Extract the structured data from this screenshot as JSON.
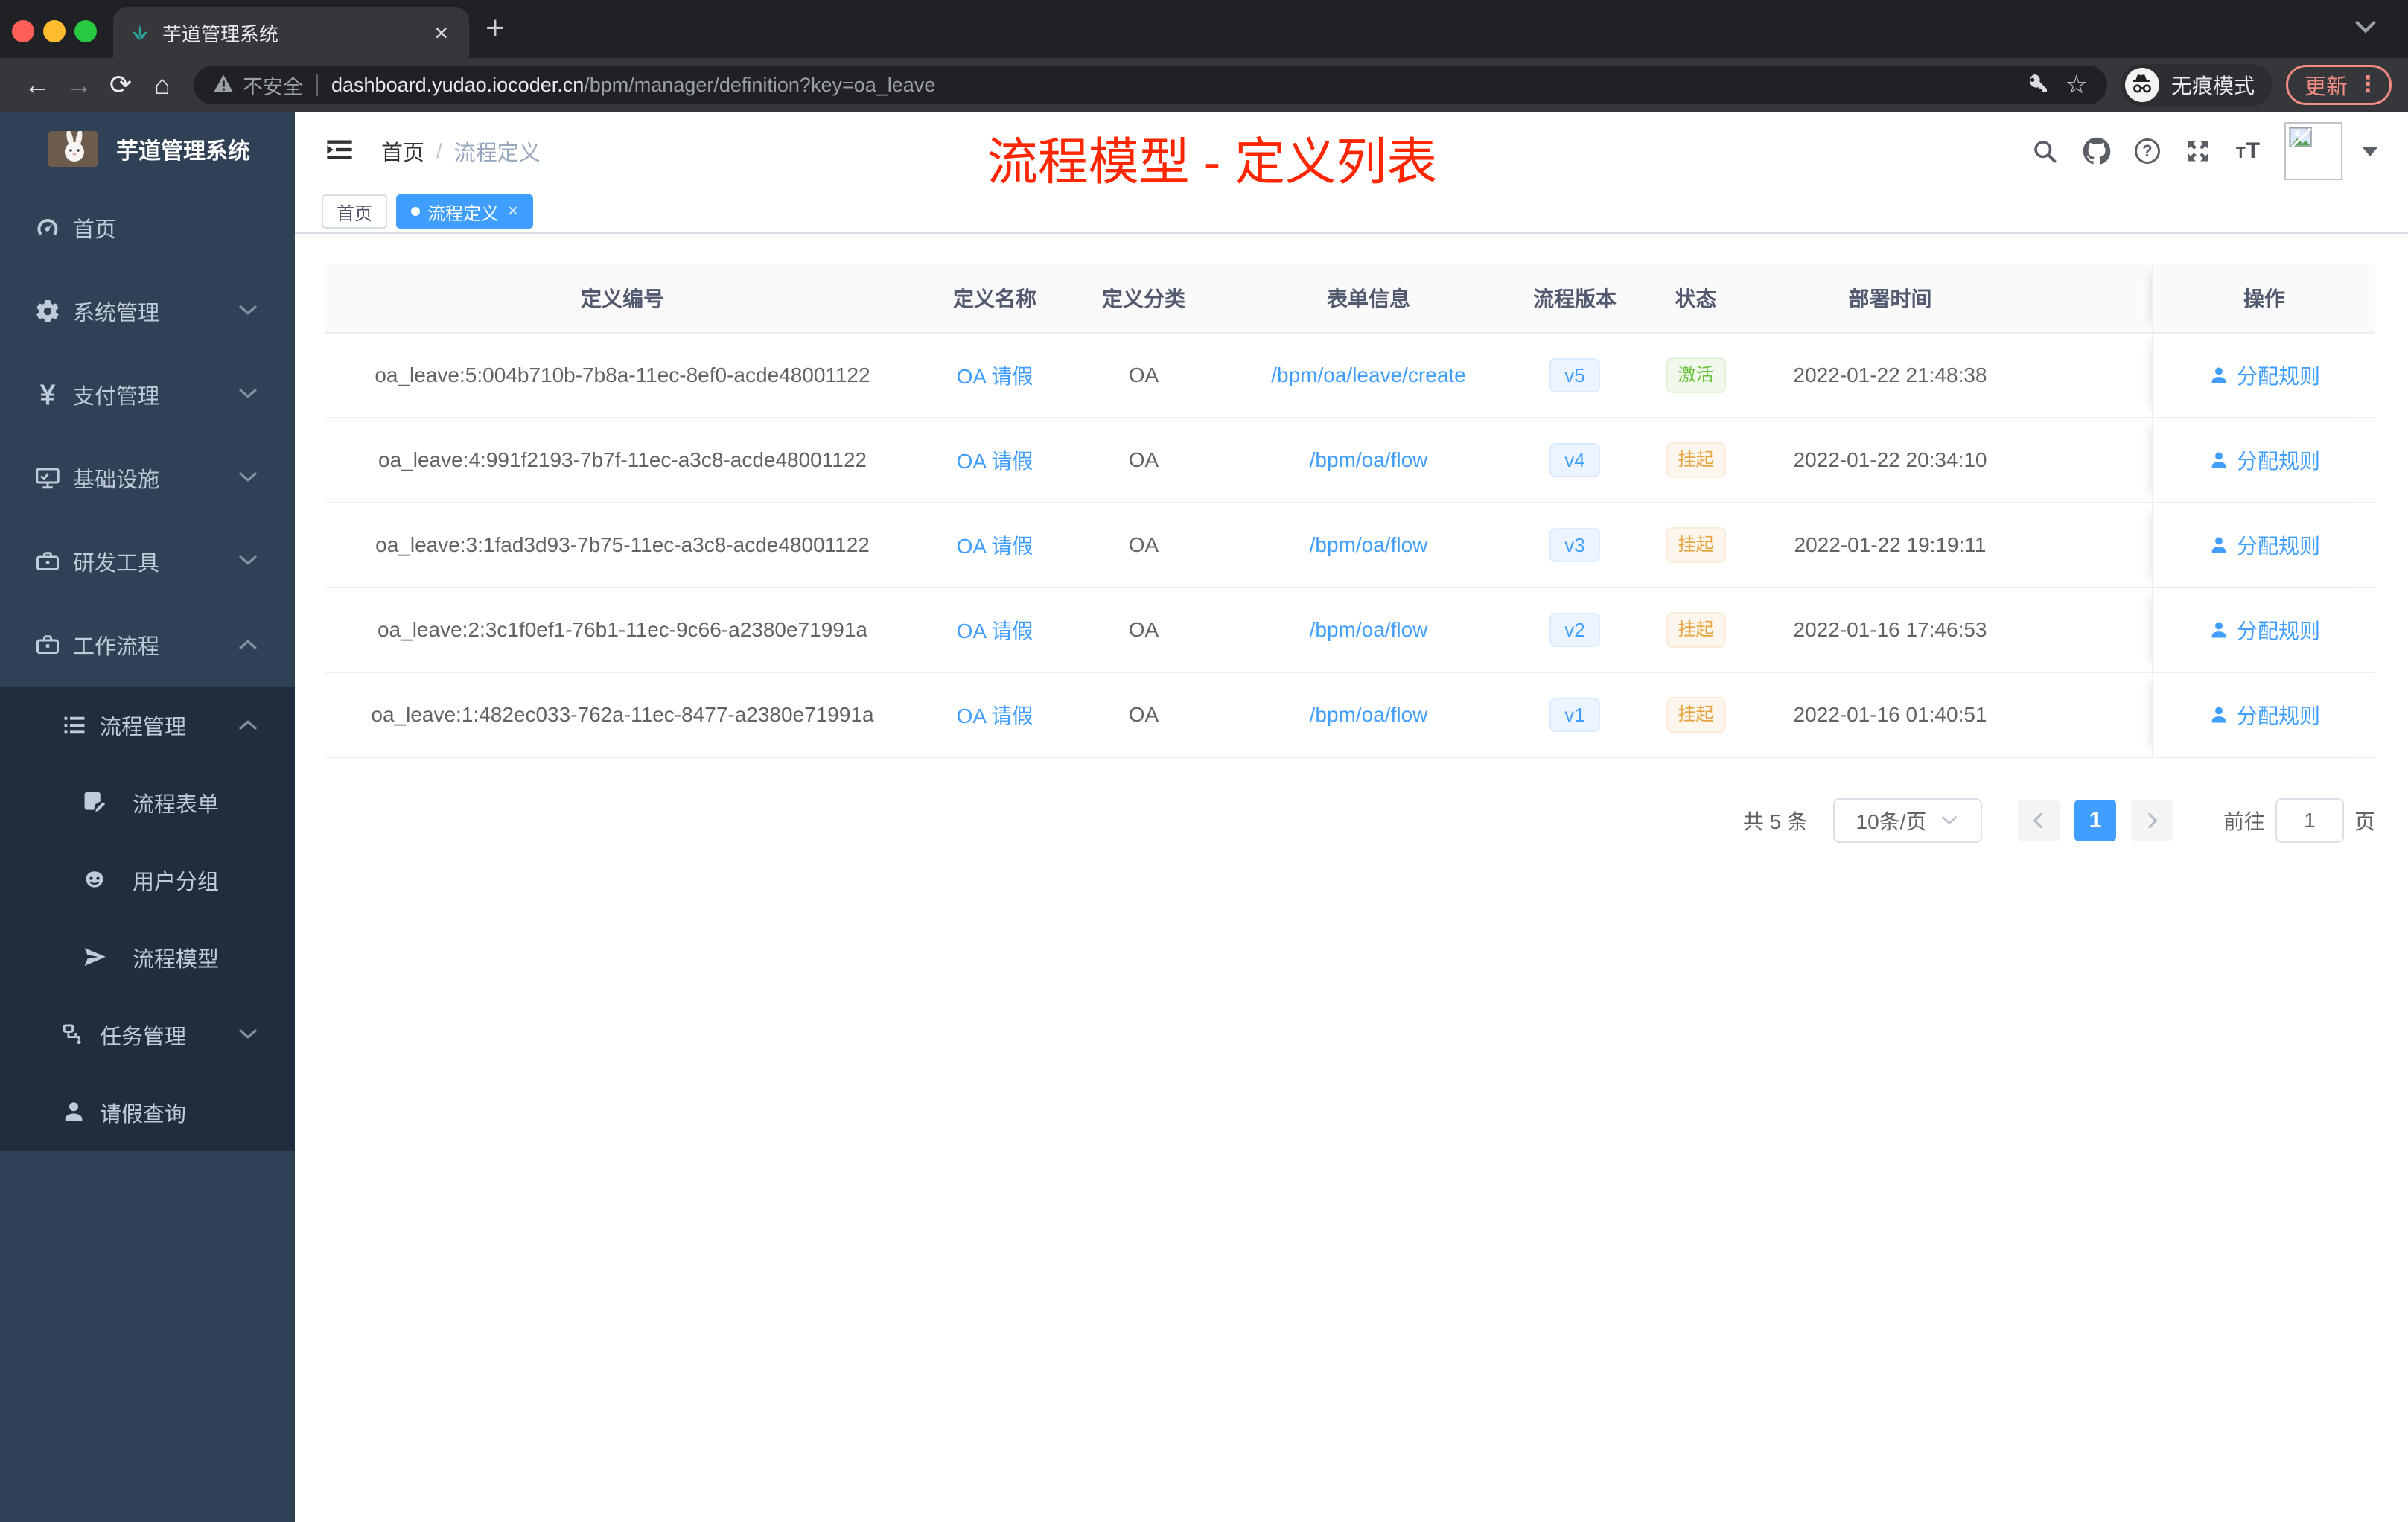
{
  "browser": {
    "tab": {
      "title": "芋道管理系统"
    },
    "address": {
      "security": "不安全",
      "host": "dashboard.yudao.iocoder.cn",
      "path": "/bpm/manager/definition?key=oa_leave"
    },
    "incognito_label": "无痕模式",
    "update_label": "更新"
  },
  "annotation": {
    "title": "流程模型 - 定义列表"
  },
  "sidebar": {
    "logo_title": "芋道管理系统",
    "menu": [
      {
        "label": "首页"
      },
      {
        "label": "系统管理"
      },
      {
        "label": "支付管理"
      },
      {
        "label": "基础设施"
      },
      {
        "label": "研发工具"
      },
      {
        "label": "工作流程"
      }
    ],
    "submenu": [
      {
        "label": "流程管理"
      },
      {
        "label": "流程表单"
      },
      {
        "label": "用户分组"
      },
      {
        "label": "流程模型"
      },
      {
        "label": "任务管理"
      },
      {
        "label": "请假查询"
      }
    ]
  },
  "header": {
    "breadcrumb_home": "首页",
    "breadcrumb_current": "流程定义"
  },
  "tags": [
    {
      "label": "首页"
    },
    {
      "label": "流程定义"
    }
  ],
  "table": {
    "columns": [
      "定义编号",
      "定义名称",
      "定义分类",
      "表单信息",
      "流程版本",
      "状态",
      "部署时间",
      "操作"
    ],
    "rows": [
      {
        "id": "oa_leave:5:004b710b-7b8a-11ec-8ef0-acde48001122",
        "name": "OA 请假",
        "category": "OA",
        "form": "/bpm/oa/leave/create",
        "version": "v5",
        "status": "激活",
        "status_type": "success",
        "deployed": "2022-01-22 21:48:38",
        "action": "分配规则"
      },
      {
        "id": "oa_leave:4:991f2193-7b7f-11ec-a3c8-acde48001122",
        "name": "OA 请假",
        "category": "OA",
        "form": "/bpm/oa/flow",
        "version": "v4",
        "status": "挂起",
        "status_type": "warning",
        "deployed": "2022-01-22 20:34:10",
        "action": "分配规则"
      },
      {
        "id": "oa_leave:3:1fad3d93-7b75-11ec-a3c8-acde48001122",
        "name": "OA 请假",
        "category": "OA",
        "form": "/bpm/oa/flow",
        "version": "v3",
        "status": "挂起",
        "status_type": "warning",
        "deployed": "2022-01-22 19:19:11",
        "action": "分配规则"
      },
      {
        "id": "oa_leave:2:3c1f0ef1-76b1-11ec-9c66-a2380e71991a",
        "name": "OA 请假",
        "category": "OA",
        "form": "/bpm/oa/flow",
        "version": "v2",
        "status": "挂起",
        "status_type": "warning",
        "deployed": "2022-01-16 17:46:53",
        "action": "分配规则"
      },
      {
        "id": "oa_leave:1:482ec033-762a-11ec-8477-a2380e71991a",
        "name": "OA 请假",
        "category": "OA",
        "form": "/bpm/oa/flow",
        "version": "v1",
        "status": "挂起",
        "status_type": "warning",
        "deployed": "2022-01-16 01:40:51",
        "action": "分配规则"
      }
    ]
  },
  "pagination": {
    "total": "共 5 条",
    "page_size": "10条/页",
    "page": "1",
    "goto": "前往",
    "unit": "页"
  },
  "icons": {
    "close": "×",
    "plus": "+",
    "back": "←",
    "forward": "→",
    "reload": "⟳",
    "home": "⌂",
    "star": "☆",
    "kebab": "⋮",
    "question": "?"
  },
  "colors": {
    "accent": "#409eff",
    "success": "#67c23a",
    "warning": "#e6a23c",
    "annotation_red": "#ff2600",
    "sidebar_bg": "#304156",
    "submenu_bg": "#1f2d3d"
  }
}
